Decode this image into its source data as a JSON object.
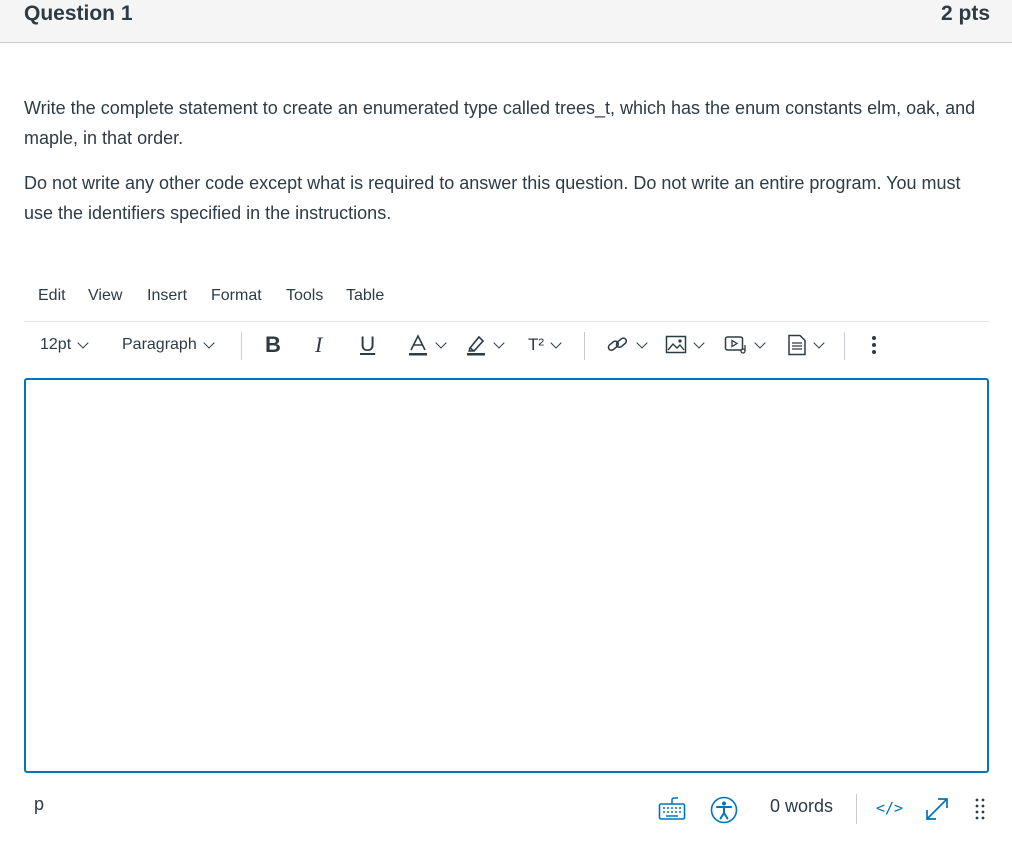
{
  "question": {
    "title": "Question 1",
    "points": "2 pts",
    "paragraph1": "Write the complete statement to create an enumerated type called trees_t, which has the enum constants elm, oak, and maple, in that order.",
    "paragraph2": "Do not write any other code except what is required to answer this question. Do not write an entire program. You must use the identifiers specified in the instructions."
  },
  "menubar": {
    "items": [
      "Edit",
      "View",
      "Insert",
      "Format",
      "Tools",
      "Table"
    ]
  },
  "toolbar": {
    "font_size": "12pt",
    "block_format": "Paragraph",
    "bold": "B",
    "italic": "I",
    "underline": "U",
    "superscript": "T²"
  },
  "statusbar": {
    "path": "p",
    "word_count": "0 words",
    "html_toggle": "</>"
  },
  "colors": {
    "accent": "#0374b5",
    "text": "#2d3b45",
    "header_bg": "#f5f5f5",
    "border": "#c7cdd1"
  },
  "icons": {
    "text_color": "text-color-icon",
    "highlight": "highlight-icon",
    "link": "link-icon",
    "image": "image-icon",
    "media": "media-icon",
    "document": "document-icon",
    "more": "more-icon",
    "keyboard": "keyboard-icon",
    "accessibility": "accessibility-icon",
    "fullscreen": "fullscreen-icon",
    "resize": "resize-handle-icon"
  }
}
